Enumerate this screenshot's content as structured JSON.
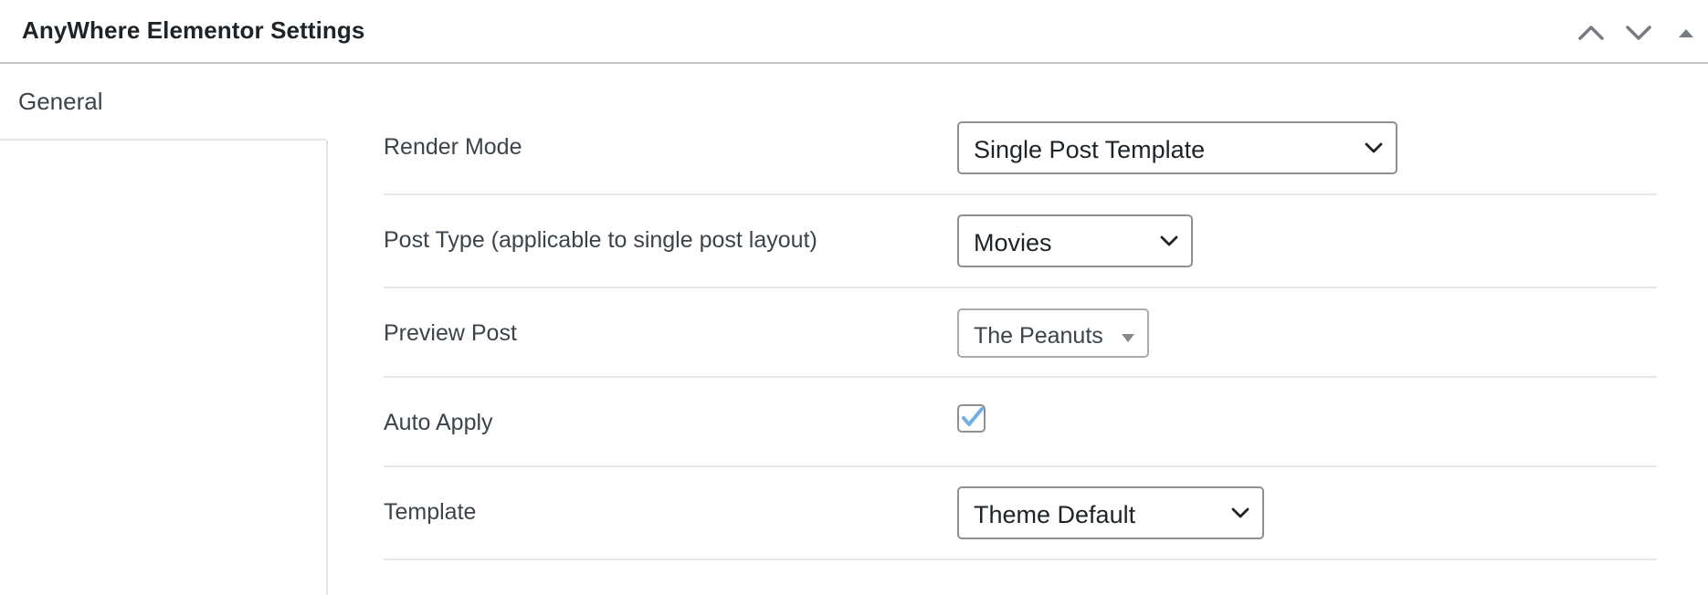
{
  "metabox": {
    "title": "AnyWhere Elementor Settings",
    "actions": [
      {
        "name": "move-up",
        "icon": "chevron-up-icon"
      },
      {
        "name": "move-down",
        "icon": "chevron-down-icon"
      },
      {
        "name": "toggle-panel",
        "icon": "triangle-up-icon"
      }
    ]
  },
  "tabs": [
    {
      "label": "General",
      "active": true
    }
  ],
  "settings": {
    "render_mode": {
      "label": "Render Mode",
      "value": "Single Post Template"
    },
    "post_type": {
      "label": "Post Type (applicable to single post layout)",
      "value": "Movies"
    },
    "preview_post": {
      "label": "Preview Post",
      "value": "The Peanuts"
    },
    "auto_apply": {
      "label": "Auto Apply",
      "checked": true
    },
    "template": {
      "label": "Template",
      "value": "Theme Default"
    }
  },
  "colors": {
    "text": "#1d2327",
    "label": "#3c434a",
    "border": "#8c8f94",
    "divider": "#e6e7e9",
    "checkmark": "#72aee6",
    "handle_icon": "#787c82"
  }
}
